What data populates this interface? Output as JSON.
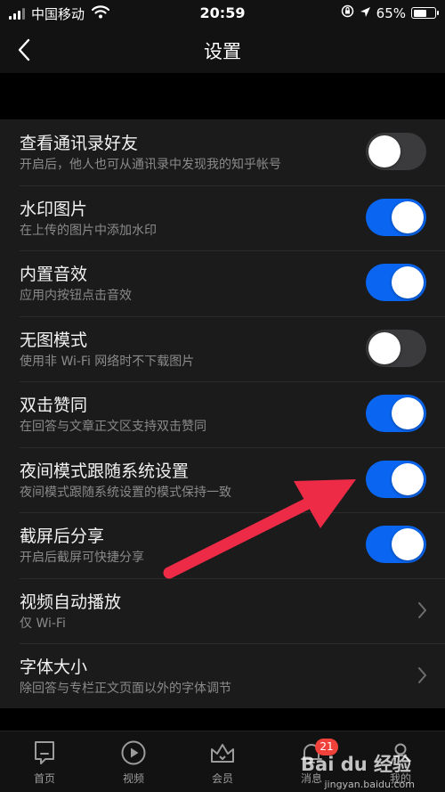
{
  "status_bar": {
    "carrier": "中国移动",
    "time": "20:59",
    "battery": "65%",
    "battery_level": 0.65
  },
  "nav": {
    "title": "设置"
  },
  "settings": [
    {
      "title": "查看通讯录好友",
      "subtitle": "开启后，他人也可从通讯录中发现我的知乎帐号",
      "control": "toggle",
      "on": false
    },
    {
      "title": "水印图片",
      "subtitle": "在上传的图片中添加水印",
      "control": "toggle",
      "on": true
    },
    {
      "title": "内置音效",
      "subtitle": "应用内按钮点击音效",
      "control": "toggle",
      "on": true
    },
    {
      "title": "无图模式",
      "subtitle": "使用非 Wi-Fi 网络时不下载图片",
      "control": "toggle",
      "on": false
    },
    {
      "title": "双击赞同",
      "subtitle": "在回答与文章正文区支持双击赞同",
      "control": "toggle",
      "on": true
    },
    {
      "title": "夜间模式跟随系统设置",
      "subtitle": "夜间模式跟随系统设置的模式保持一致",
      "control": "toggle",
      "on": true
    },
    {
      "title": "截屏后分享",
      "subtitle": "开启后截屏可快捷分享",
      "control": "toggle",
      "on": true
    },
    {
      "title": "视频自动播放",
      "subtitle": "仅 Wi-Fi",
      "control": "chevron"
    },
    {
      "title": "字体大小",
      "subtitle": "除回答与专栏正文页面以外的字体调节",
      "control": "chevron"
    }
  ],
  "tab_bar": {
    "tabs": [
      {
        "label": "首页",
        "icon": "home-icon"
      },
      {
        "label": "视频",
        "icon": "play-icon"
      },
      {
        "label": "会员",
        "icon": "crown-icon"
      },
      {
        "label": "消息",
        "icon": "bell-icon",
        "badge": "21"
      },
      {
        "label": "我的",
        "icon": "profile-icon"
      }
    ]
  },
  "watermark": {
    "brand": "Bai du 经验",
    "url": "jingyan.baidu.com"
  },
  "colors": {
    "toggle_on": "#0a66f0",
    "toggle_off": "#3b3b3d",
    "annotation_arrow": "#ee2b47",
    "badge": "#f0413a"
  }
}
